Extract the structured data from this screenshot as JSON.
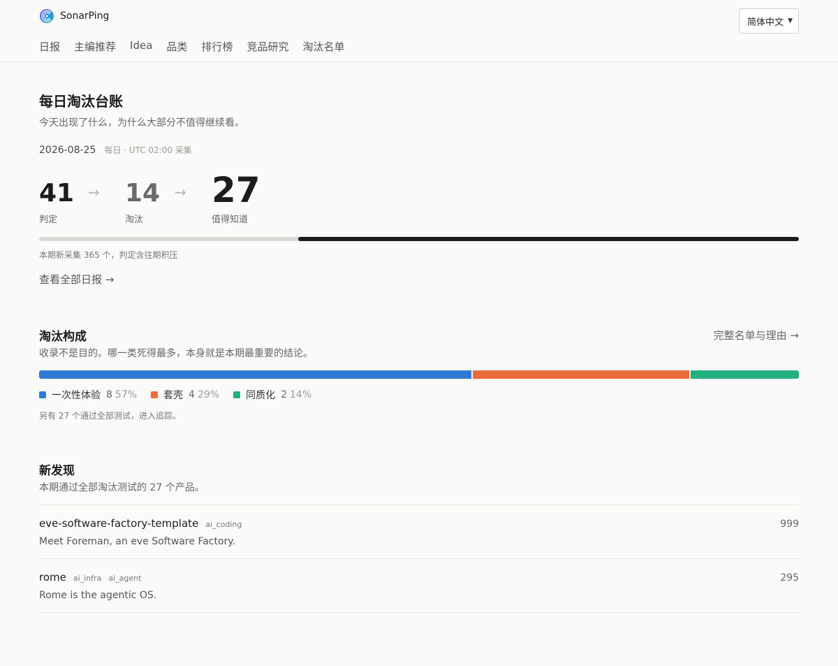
{
  "brand": {
    "name": "SonarPing"
  },
  "language": {
    "selected": "简体中文"
  },
  "nav": [
    "日报",
    "主编推荐",
    "Idea",
    "品类",
    "排行榜",
    "竞品研究",
    "淘汰名单"
  ],
  "page": {
    "title": "每日淘汰台账",
    "subtitle": "今天出现了什么，为什么大部分不值得继续看。",
    "date": "2026-08-25",
    "date_note": "每日 · UTC 02:00 采集"
  },
  "funnel": {
    "judged": {
      "value": "41",
      "label": "判定"
    },
    "eliminated": {
      "value": "14",
      "label": "淘汰"
    },
    "worth": {
      "value": "27",
      "label": "值得知道"
    },
    "progress_fraction": 0.659,
    "note": "本期新采集 365 个，判定含往期积压",
    "link": "查看全部日报 →"
  },
  "composition": {
    "title": "淘汰构成",
    "subtitle": "收录不是目的。哪一类死得最多，本身就是本期最重要的结论。",
    "link": "完整名单与理由 →",
    "segments": [
      {
        "name": "一次性体验",
        "count": "8",
        "pct": "57%",
        "value": 8,
        "color": "#2f7ad6"
      },
      {
        "name": "套壳",
        "count": "4",
        "pct": "29%",
        "value": 4,
        "color": "#ec6b3a"
      },
      {
        "name": "同质化",
        "count": "2",
        "pct": "14%",
        "value": 2,
        "color": "#23b07f"
      }
    ],
    "note": "另有 27 个通过全部测试，进入追踪。"
  },
  "discoveries": {
    "title": "新发现",
    "subtitle": "本期通过全部淘汰测试的 27 个产品。",
    "items": [
      {
        "name": "eve-software-factory-template",
        "tags": [
          "ai_coding"
        ],
        "description": "Meet Foreman, an eve Software Factory.",
        "score": "999"
      },
      {
        "name": "rome",
        "tags": [
          "ai_infra",
          "ai_agent"
        ],
        "description": "Rome is the agentic OS.",
        "score": "295"
      }
    ]
  }
}
